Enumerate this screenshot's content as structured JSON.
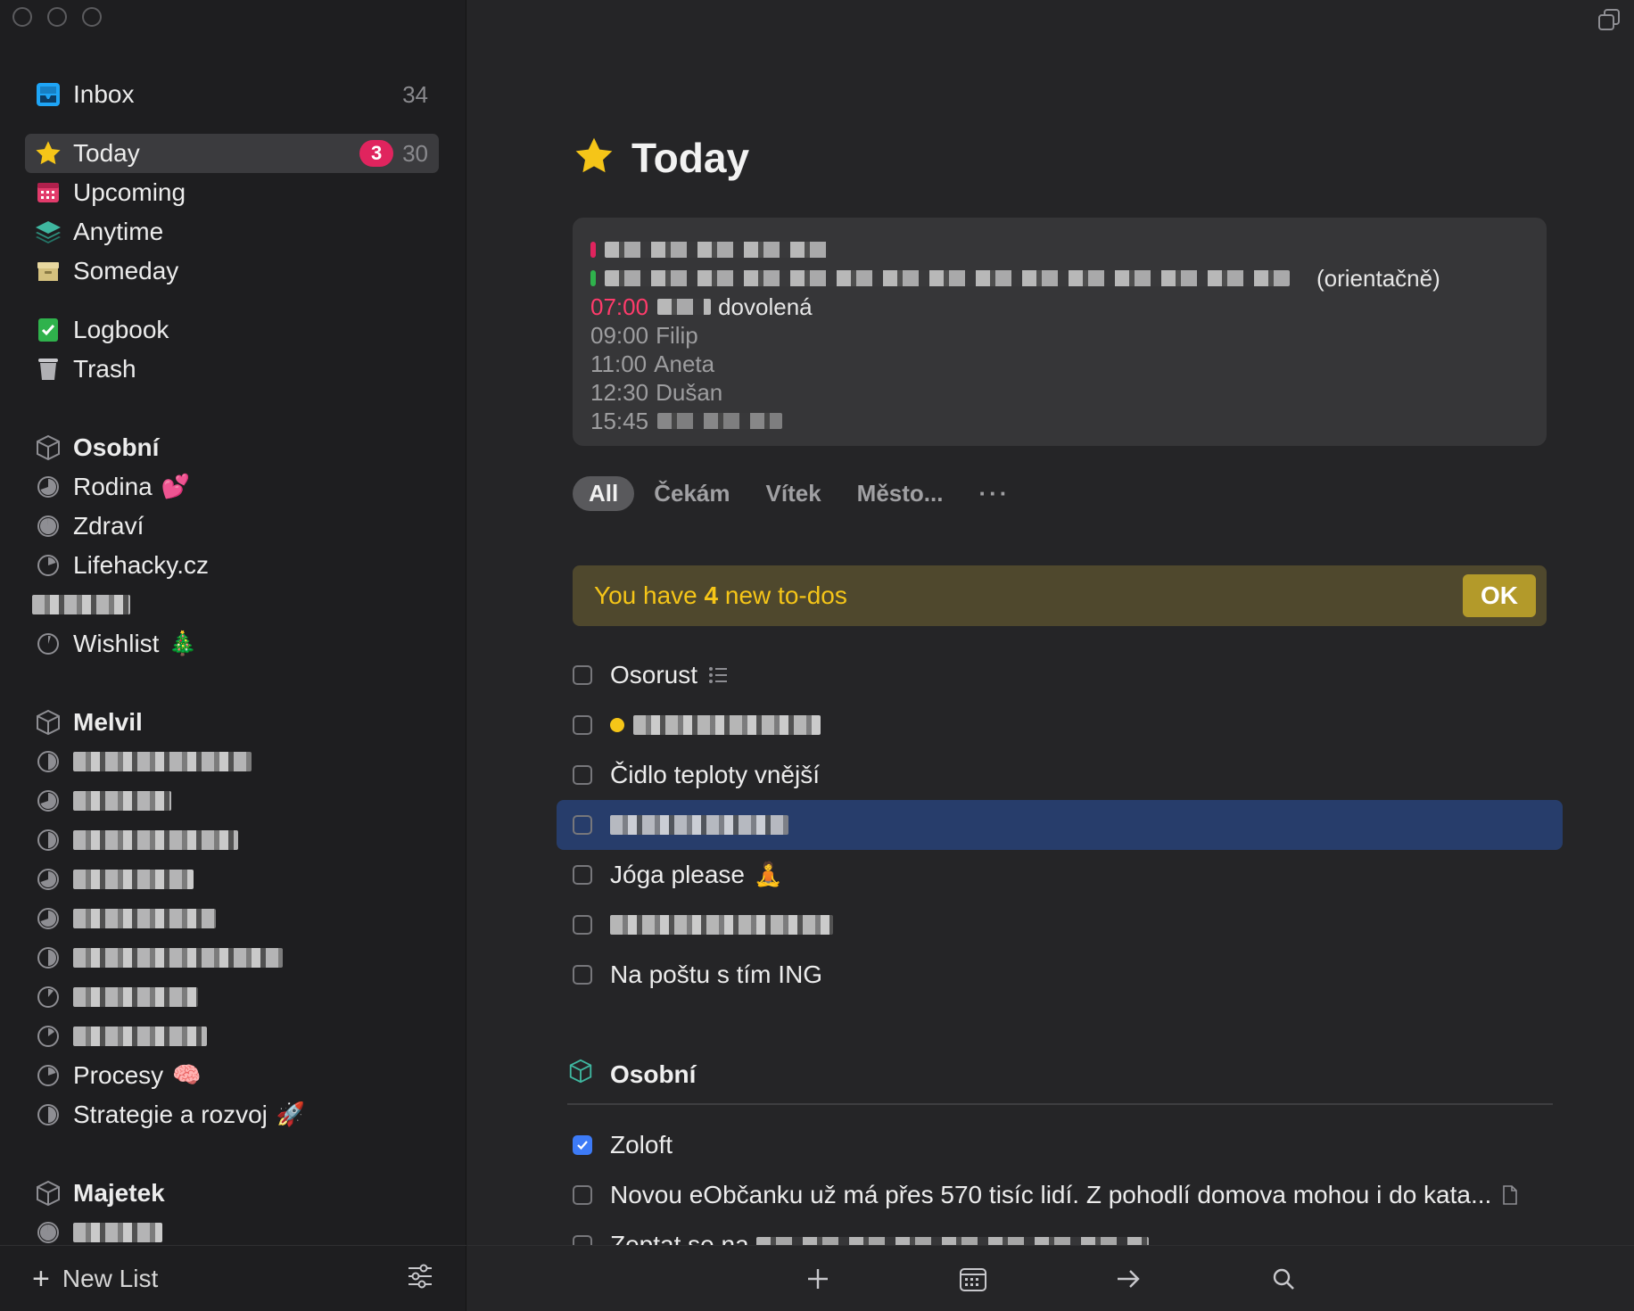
{
  "sidebar": {
    "inbox": {
      "label": "Inbox",
      "count": "34"
    },
    "today": {
      "label": "Today",
      "badge": "3",
      "count": "30"
    },
    "upcoming": {
      "label": "Upcoming"
    },
    "anytime": {
      "label": "Anytime"
    },
    "someday": {
      "label": "Someday"
    },
    "logbook": {
      "label": "Logbook"
    },
    "trash": {
      "label": "Trash"
    },
    "areas": [
      {
        "title": "Osobní",
        "projects": [
          "Rodina",
          "Zdraví",
          "Lifehacky.cz",
          "Wishlist"
        ]
      },
      {
        "title": "Melvil",
        "projects": [
          "Procesy",
          "Strategie a rozvoj"
        ]
      },
      {
        "title": "Majetek"
      }
    ],
    "emoji": {
      "rodina": "💕",
      "wishlist": "🎄",
      "procesy": "🧠",
      "strategie": "🚀"
    },
    "footer": {
      "new_list": "New List"
    }
  },
  "main": {
    "title": "Today",
    "calendar": {
      "note": "(orientačně)",
      "events": [
        {
          "time": "07:00",
          "text": "dovolená"
        },
        {
          "time": "09:00",
          "text": "Filip"
        },
        {
          "time": "11:00",
          "text": "Aneta"
        },
        {
          "time": "12:30",
          "text": "Dušan"
        },
        {
          "time": "15:45",
          "text": ""
        }
      ]
    },
    "tabs": [
      "All",
      "Čekám",
      "Vítek",
      "Město...",
      "···"
    ],
    "banner": {
      "prefix": "You have ",
      "count": "4",
      "suffix": " new to-dos",
      "ok": "OK"
    },
    "todos": [
      "Osorust",
      "",
      "Čidlo teploty vnější",
      "",
      "Jóga please",
      "",
      "Na poštu s tím ING"
    ],
    "todo_emoji": {
      "joga": "🧘"
    },
    "section": {
      "title": "Osobní"
    },
    "section_todos": [
      "Zoloft",
      "Novou eObčanku už má přes 570 tisíc lidí. Z pohodlí domova mohou i do kata...",
      "Zeptat se na"
    ]
  },
  "colors": {
    "accent_blue": "#3d7bf7",
    "badge_red": "#e0245e",
    "star_yellow": "#f5c518",
    "selected_row": "#273d6b",
    "banner_bg": "#4f482d"
  }
}
